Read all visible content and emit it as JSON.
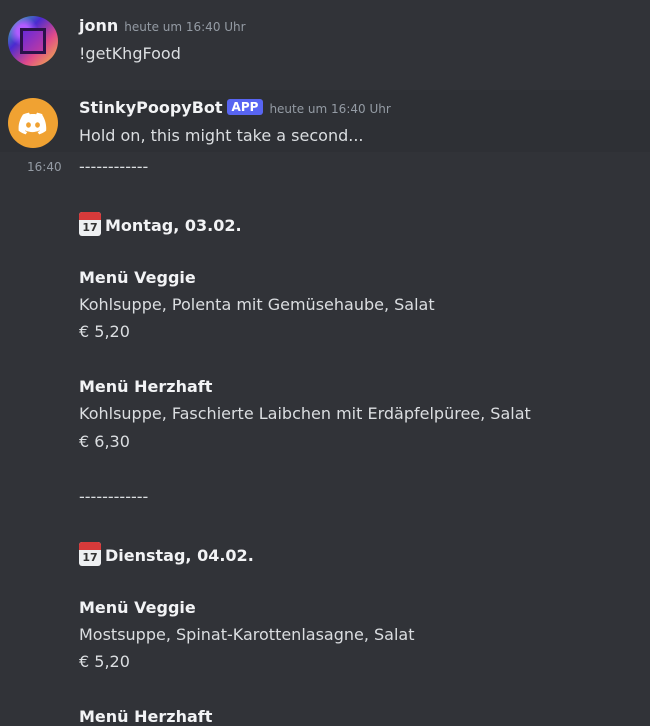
{
  "messages": [
    {
      "author": "jonn",
      "timestamp": "heute um 16:40 Uhr",
      "text": "!getKhgFood"
    },
    {
      "author": "StinkyPoopyBot",
      "badge": "APP",
      "timestamp": "heute um 16:40 Uhr",
      "text": "Hold on, this might take a second..."
    }
  ],
  "followup": {
    "side_timestamp": "16:40",
    "separator1": "------------",
    "day1": {
      "calendar_digits": "17",
      "title": "Montag, 03.02.",
      "menu1_title": "Menü Veggie",
      "menu1_desc": "Kohlsuppe, Polenta mit Gemüsehaube, Salat",
      "menu1_price": "€ 5,20",
      "menu2_title": "Menü Herzhaft",
      "menu2_desc": "Kohlsuppe, Faschierte Laibchen mit Erdäpfelpüree, Salat",
      "menu2_price": "€ 6,30"
    },
    "separator2": "------------",
    "day2": {
      "calendar_digits": "17",
      "title": "Dienstag, 04.02.",
      "menu1_title": "Menü Veggie",
      "menu1_desc": "Mostsuppe, Spinat-Karottenlasagne, Salat",
      "menu1_price": "€ 5,20",
      "menu2_title": "Menü Herzhaft"
    }
  },
  "colors": {
    "background": "#313338",
    "accent_badge": "#5865f2",
    "bot_avatar": "#f0a232"
  },
  "icons": {
    "bot_avatar": "discord-logo-icon",
    "calendar": "calendar-icon"
  }
}
